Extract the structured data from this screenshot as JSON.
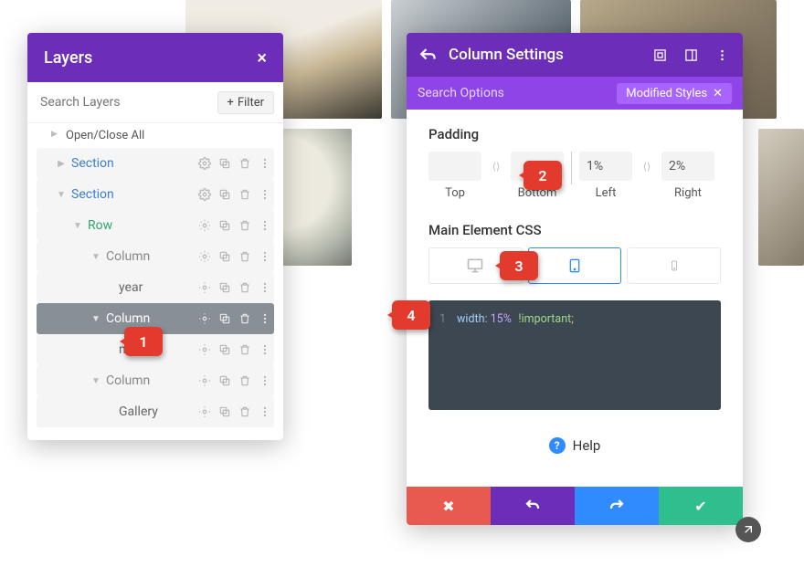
{
  "layers": {
    "title": "Layers",
    "search_placeholder": "Search Layers",
    "filter_label": "Filter",
    "open_close": "Open/Close All",
    "tree": {
      "section1": "Section",
      "section2": "Section",
      "row": "Row",
      "col1": "Column",
      "year": "year",
      "col2": "Column",
      "month": "month",
      "col3": "Column",
      "gallery": "Gallery"
    }
  },
  "settings": {
    "title": "Column Settings",
    "search_placeholder": "Search Options",
    "modified_label": "Modified Styles",
    "padding_label": "Padding",
    "padding": {
      "top_label": "Top",
      "bottom_label": "Bottom",
      "left_label": "Left",
      "right_label": "Right",
      "top_value": "",
      "bottom_value": "",
      "left_value": "1%",
      "right_value": "2%"
    },
    "main_css_label": "Main Element CSS",
    "device_tabs": {
      "desktop": "desktop",
      "tablet": "tablet",
      "phone": "phone"
    },
    "css": {
      "line_no": "1",
      "prop": "width",
      "value": "15%",
      "important": "!important"
    },
    "help_label": "Help"
  },
  "callouts": {
    "c1": "1",
    "c2": "2",
    "c3": "3",
    "c4": "4"
  }
}
